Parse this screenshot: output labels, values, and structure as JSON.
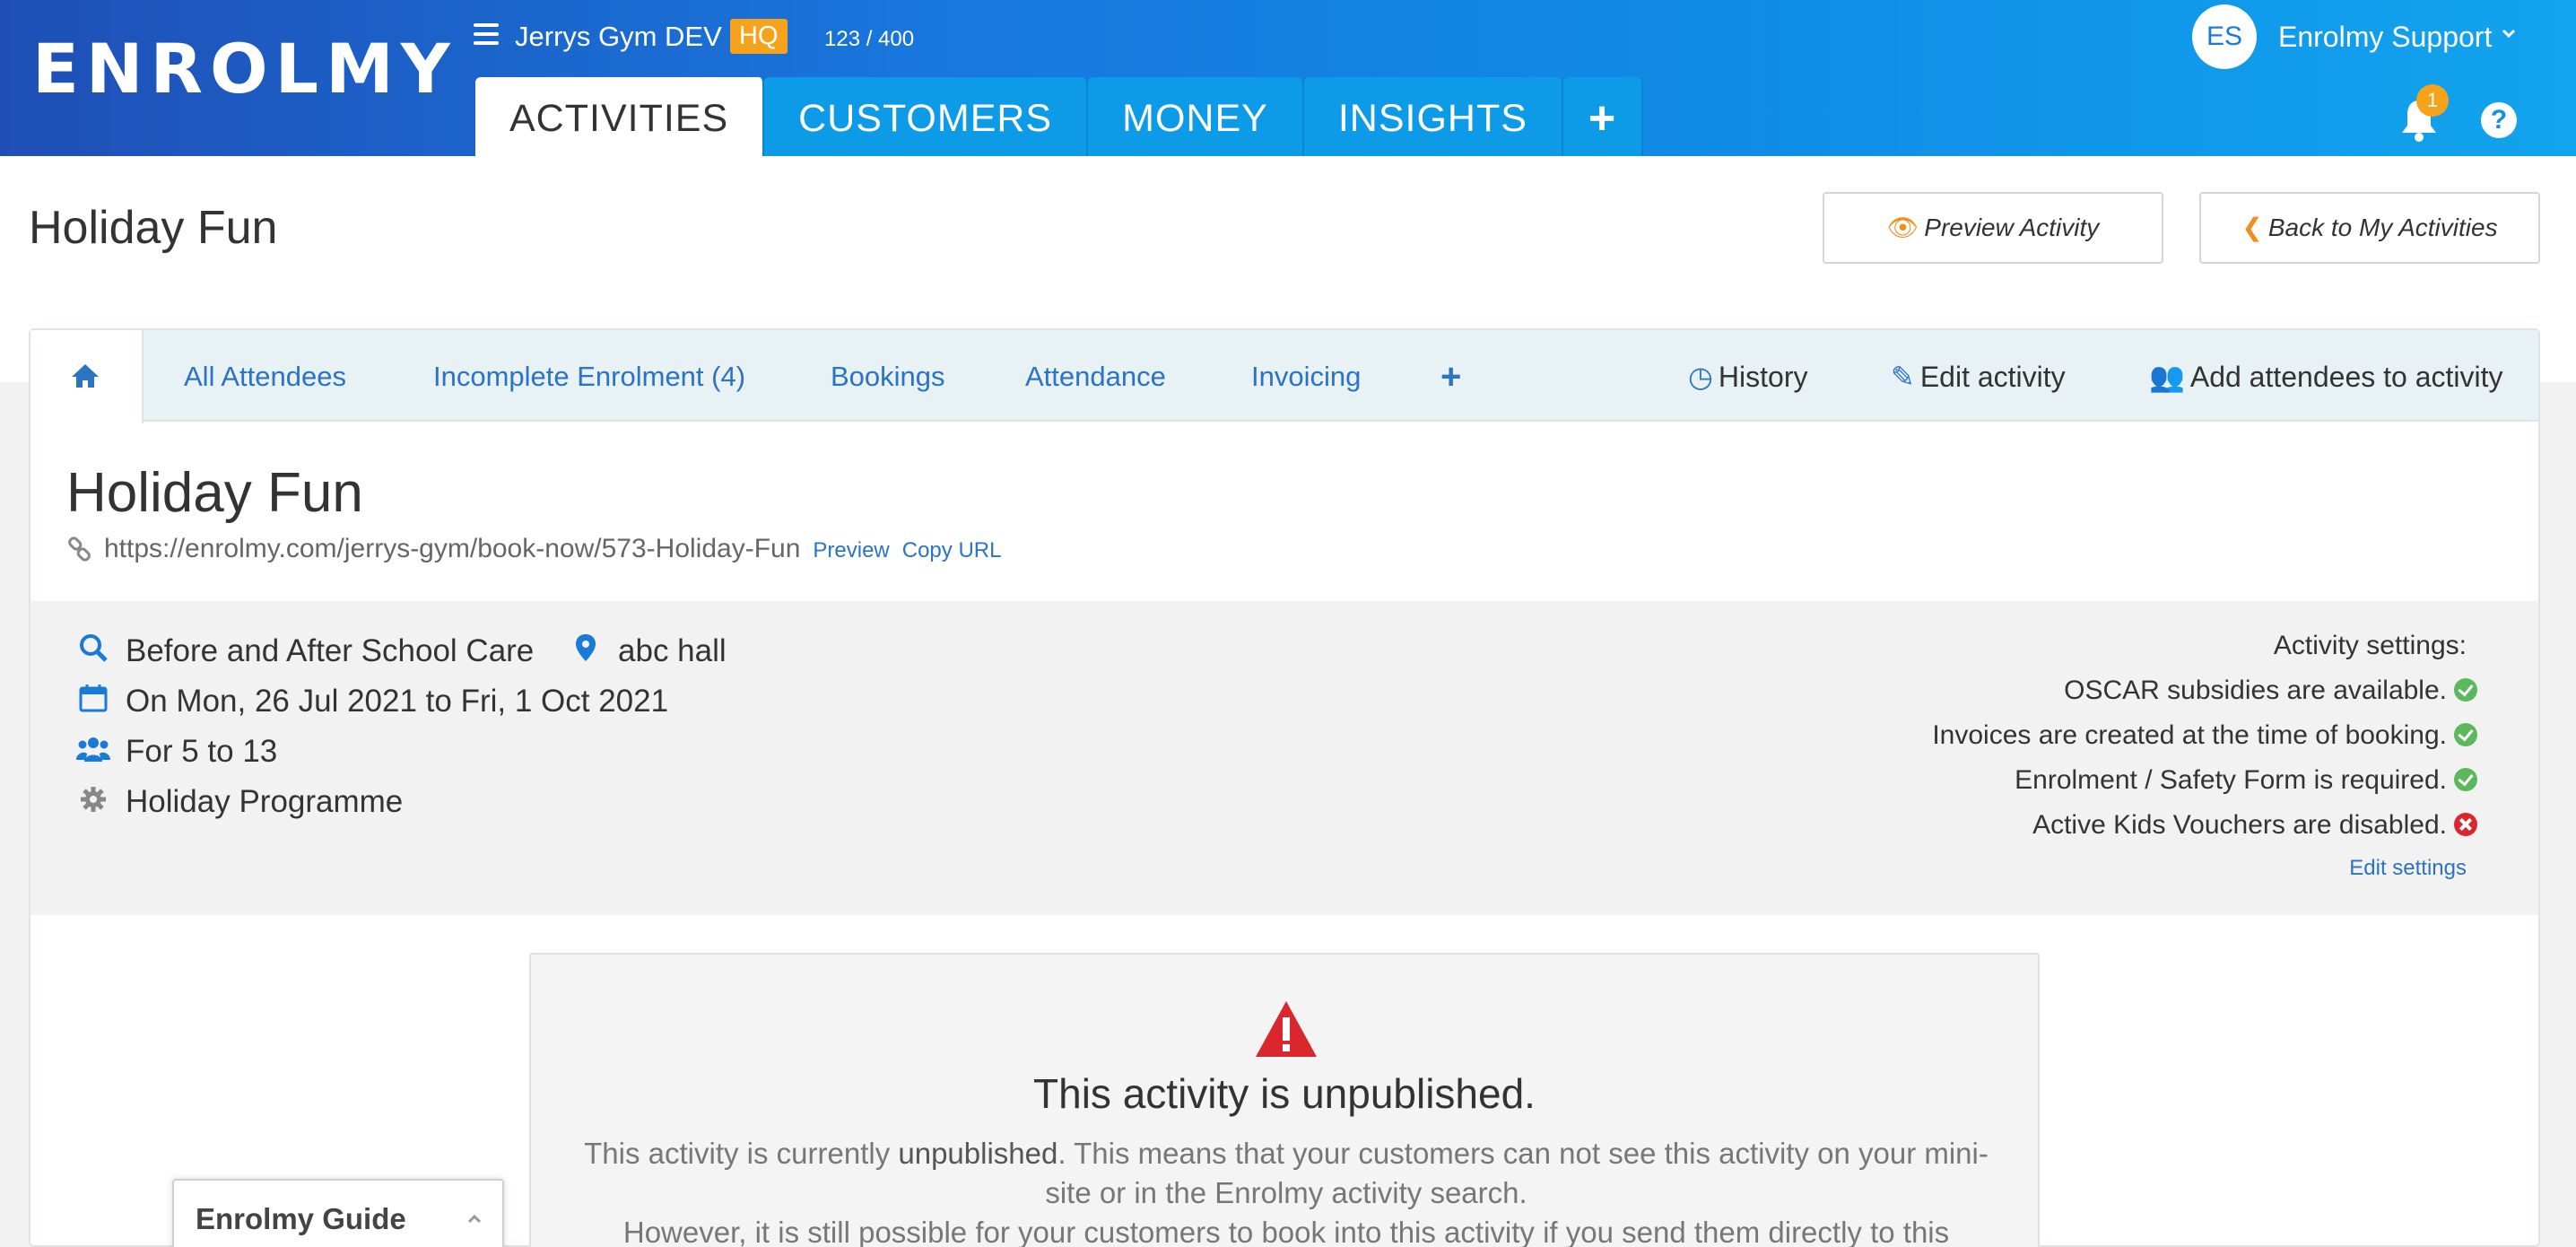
{
  "brand": {
    "logo_text": "ENROLMY"
  },
  "org": {
    "name": "Jerrys Gym DEV",
    "badge": "HQ",
    "counter": "123 / 400"
  },
  "main_tabs": [
    {
      "label": "ACTIVITIES"
    },
    {
      "label": "CUSTOMERS"
    },
    {
      "label": "MONEY"
    },
    {
      "label": "INSIGHTS"
    },
    {
      "label": "+"
    }
  ],
  "user": {
    "initials": "ES",
    "name": "Enrolmy Support",
    "notification_count": "1",
    "help": "?"
  },
  "page": {
    "title": "Holiday Fun"
  },
  "header_buttons": {
    "preview": "Preview Activity",
    "back": "Back to My Activities"
  },
  "sub_tabs": [
    {
      "label": "All Attendees"
    },
    {
      "label": "Incomplete Enrolment (4)"
    },
    {
      "label": "Bookings"
    },
    {
      "label": "Attendance"
    },
    {
      "label": "Invoicing"
    },
    {
      "label": "+"
    }
  ],
  "sub_actions": {
    "history": "History",
    "edit": "Edit activity",
    "add": "Add attendees to activity"
  },
  "activity": {
    "title": "Holiday Fun",
    "url": "https://enrolmy.com/jerrys-gym/book-now/573-Holiday-Fun",
    "preview_link": "Preview",
    "copy_link": "Copy URL",
    "category": "Before and After School Care",
    "location": "abc hall",
    "dates": "On Mon, 26 Jul 2021 to Fri, 1 Oct 2021",
    "ages": "For 5 to 13",
    "type": "Holiday Programme"
  },
  "settings": {
    "heading": "Activity settings:",
    "items": [
      {
        "text": "OSCAR subsidies are available.",
        "status": "ok"
      },
      {
        "text": "Invoices are created at the time of booking.",
        "status": "ok"
      },
      {
        "text": "Enrolment / Safety Form is required.",
        "status": "ok"
      },
      {
        "text": "Active Kids Vouchers are disabled.",
        "status": "no"
      }
    ],
    "edit_link": "Edit settings"
  },
  "notice": {
    "title": "This activity is unpublished.",
    "line1_pre": "This activity is currently ",
    "line1_bold": "unpublished",
    "line1_post": ". This means that your customers can not see this activity on your mini-site or in the Enrolmy activity search.",
    "line2": "However, it is still possible for your customers to book into this activity if you send them directly to this"
  },
  "guide": {
    "label": "Enrolmy Guide"
  },
  "colors": {
    "brand_blue": "#1876dc",
    "accent_orange": "#f6a21b",
    "link_blue": "#2a73c5",
    "ok_green": "#5cb85c",
    "error_red": "#d9272d"
  }
}
